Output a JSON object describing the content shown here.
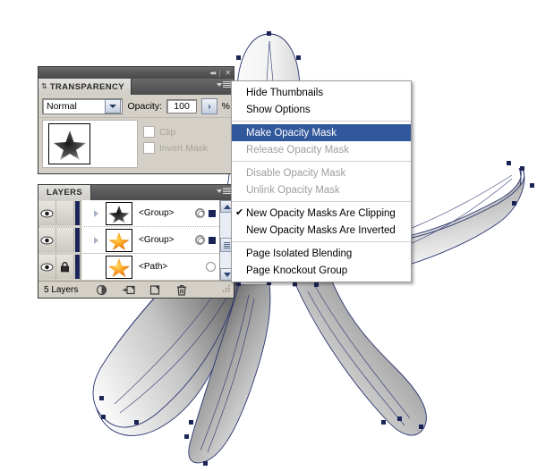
{
  "app": {
    "title": "Adobe Illustrator Transparency and Layers panels"
  },
  "transparency_panel": {
    "titlebar": {
      "collapse_icon": "◂◂",
      "close_icon": "✕"
    },
    "tab_label": "TRANSPARENCY",
    "tab_grip": "⇅",
    "blend_mode": {
      "value": "Normal",
      "placeholder": "Normal"
    },
    "opacity": {
      "label": "Opacity:",
      "value": "100",
      "stepper": "›",
      "unit": "%"
    },
    "clip": {
      "label": "Clip",
      "checked": false
    },
    "invert_mask": {
      "label": "Invert Mask",
      "checked": false
    }
  },
  "layers_panel": {
    "tab_label": "LAYERS",
    "rows": [
      {
        "name": "<Group>",
        "thumb": "black-star",
        "has_lock": false,
        "expandable": true,
        "selected": true
      },
      {
        "name": "<Group>",
        "thumb": "orange-star",
        "has_lock": false,
        "expandable": true,
        "selected": true
      },
      {
        "name": "<Path>",
        "thumb": "orange-star",
        "has_lock": true,
        "expandable": false,
        "selected": false
      }
    ],
    "footer": {
      "count_label": "5 Layers",
      "icons": [
        "make-clipping-mask-icon",
        "new-sublayer-icon",
        "new-layer-icon",
        "delete-layer-icon"
      ]
    },
    "scrollbar": {
      "up_icon": "▲",
      "down_icon": "▼"
    }
  },
  "context_menu": {
    "items": [
      {
        "label": "Hide Thumbnails",
        "state": "normal",
        "checked": false
      },
      {
        "label": "Show Options",
        "state": "normal",
        "checked": false
      },
      {
        "separator": true
      },
      {
        "label": "Make Opacity Mask",
        "state": "selected",
        "checked": false
      },
      {
        "label": "Release Opacity Mask",
        "state": "disabled",
        "checked": false
      },
      {
        "separator": true
      },
      {
        "label": "Disable Opacity Mask",
        "state": "disabled",
        "checked": false
      },
      {
        "label": "Unlink Opacity Mask",
        "state": "disabled",
        "checked": false
      },
      {
        "separator": true
      },
      {
        "label": "New Opacity Masks Are Clipping",
        "state": "normal",
        "checked": true
      },
      {
        "label": "New Opacity Masks Are Inverted",
        "state": "normal",
        "checked": false
      },
      {
        "separator": true
      },
      {
        "label": "Page Isolated Blending",
        "state": "normal",
        "checked": false
      },
      {
        "label": "Page Knockout Group",
        "state": "normal",
        "checked": false
      }
    ],
    "check_glyph": "✔"
  },
  "artwork": {
    "description": "five-armed starfish vector path with grayscale gradient fill and selected anchor points",
    "path_stroke": "#2a3570",
    "anchor_color": "#1b2456",
    "canvas_background": "#ffffff"
  },
  "colors": {
    "menu_highlight": "#31589c",
    "panel_face": "#d4d0c8",
    "panel_header_dark": "#5a5a5a",
    "selection_navy": "#1b2456"
  }
}
